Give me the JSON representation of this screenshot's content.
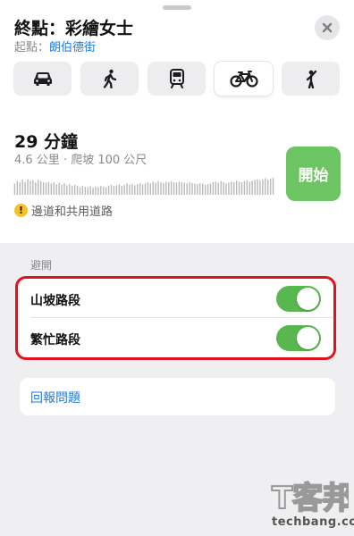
{
  "header": {
    "destination": "終點：彩繪女士",
    "origin_label": "起點：",
    "origin_value": "朗伯德街"
  },
  "close_icon": "close-icon",
  "transport_modes": [
    {
      "name": "car",
      "icon": "car-icon",
      "selected": false
    },
    {
      "name": "walk",
      "icon": "walk-icon",
      "selected": false
    },
    {
      "name": "transit",
      "icon": "train-icon",
      "selected": false
    },
    {
      "name": "bicycle",
      "icon": "bicycle-icon",
      "selected": true
    },
    {
      "name": "rideshare",
      "icon": "rideshare-icon",
      "selected": false
    }
  ],
  "route": {
    "time": "29 分鐘",
    "details": "4.6 公里 · 爬坡 100 公尺",
    "start_label": "開始",
    "warning": "邊道和共用道路",
    "elevation_profile": [
      0.45,
      0.55,
      0.5,
      0.6,
      0.5,
      0.62,
      0.55,
      0.58,
      0.5,
      0.6,
      0.55,
      0.5,
      0.48,
      0.52,
      0.45,
      0.5,
      0.42,
      0.48,
      0.4,
      0.45,
      0.38,
      0.42,
      0.36,
      0.4,
      0.35,
      0.3,
      0.36,
      0.32,
      0.3,
      0.34,
      0.28,
      0.33,
      0.3,
      0.35,
      0.32,
      0.3,
      0.36,
      0.4,
      0.35,
      0.38,
      0.42,
      0.36,
      0.4,
      0.45,
      0.4,
      0.43,
      0.38,
      0.42,
      0.46,
      0.4,
      0.45,
      0.5,
      0.46,
      0.52,
      0.48,
      0.55,
      0.5,
      0.47,
      0.52,
      0.5,
      0.55,
      0.5,
      0.48,
      0.53,
      0.5,
      0.48,
      0.45,
      0.5,
      0.47,
      0.44,
      0.42,
      0.46,
      0.44,
      0.4,
      0.42,
      0.45,
      0.5,
      0.52,
      0.48,
      0.55,
      0.5,
      0.45,
      0.48,
      0.52,
      0.5,
      0.56,
      0.52,
      0.5,
      0.55,
      0.58,
      0.52,
      0.56,
      0.6,
      0.62,
      0.58,
      0.62,
      0.66,
      0.6,
      0.64,
      0.68
    ]
  },
  "avoid": {
    "title": "避開",
    "options": [
      {
        "label": "山坡路段",
        "enabled": true
      },
      {
        "label": "繁忙路段",
        "enabled": true
      }
    ]
  },
  "report": {
    "label": "回報問題"
  },
  "watermark": {
    "logo_text": "T客邦",
    "text": "techbang.com"
  },
  "colors": {
    "accent_blue": "#1f7ae0",
    "go_green": "#6cc462",
    "toggle_green": "#58b84f",
    "highlight_red": "#e0121f",
    "warning_yellow": "#f6c12b"
  }
}
